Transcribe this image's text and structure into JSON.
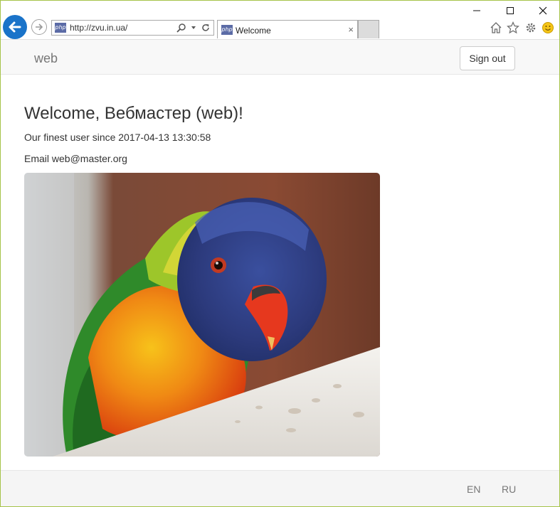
{
  "browser": {
    "url": "http://zvu.in.ua/",
    "tab_title": "Welcome",
    "favicon_text": "php",
    "tab_close": "×",
    "icons": [
      "back-arrow-icon",
      "forward-arrow-icon",
      "search-icon",
      "dropdown-icon",
      "refresh-icon",
      "home-icon",
      "star-icon",
      "gear-icon",
      "smiley-icon",
      "minimize-icon",
      "maximize-icon",
      "close-icon"
    ]
  },
  "navbar": {
    "brand": "web",
    "sign_out_label": "Sign out"
  },
  "main": {
    "heading": "Welcome, Вебмастер (web)!",
    "since_text": "Our finest user since 2017-04-13 13:30:58",
    "email_text": "Email web@master.org",
    "image_subject": "rainbow-lorikeet-parrot"
  },
  "footer": {
    "languages": [
      "EN",
      "RU"
    ]
  },
  "colors": {
    "frame_border": "#a6c34a",
    "back_button": "#1a73c9",
    "navbar_bg": "#f8f8f8",
    "footer_bg": "#f5f5f5"
  }
}
